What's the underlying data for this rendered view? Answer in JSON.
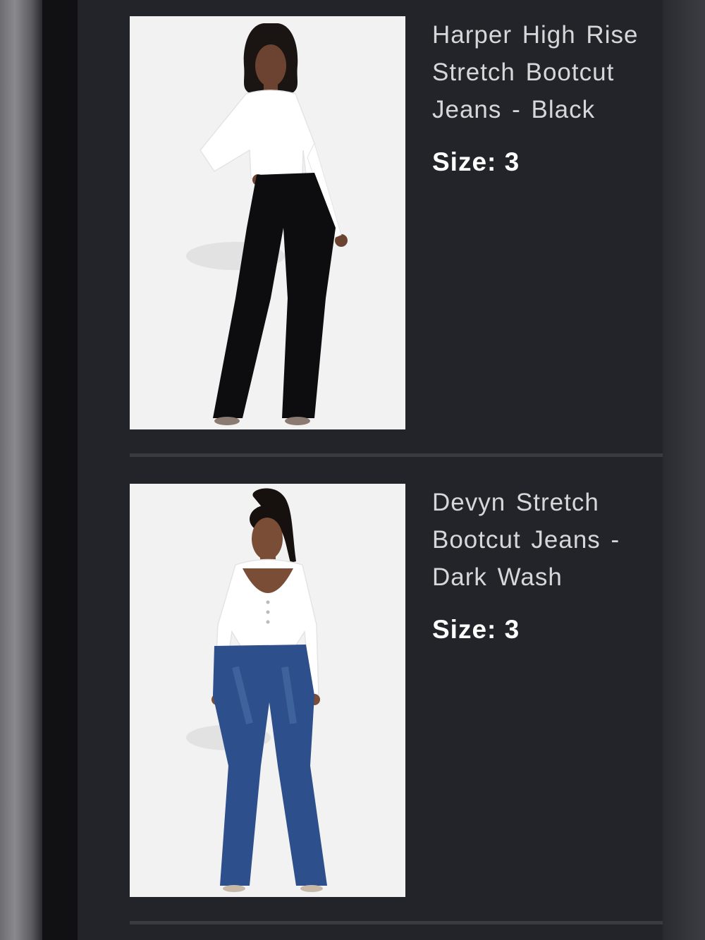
{
  "products": [
    {
      "name": "Harper High Rise Stretch Bootcut Jeans - Black",
      "size_label": "Size:",
      "size_value": "3",
      "image_desc": "model in white top and black bootcut jeans"
    },
    {
      "name": "Devyn Stretch Bootcut Jeans - Dark Wash",
      "size_label": "Size:",
      "size_value": "3",
      "image_desc": "model in white top and dark wash bootcut jeans"
    }
  ],
  "colors": {
    "background": "#23242a",
    "name_text": "#d7d7d9",
    "size_text": "#ffffff",
    "divider": "#3a3b40"
  }
}
